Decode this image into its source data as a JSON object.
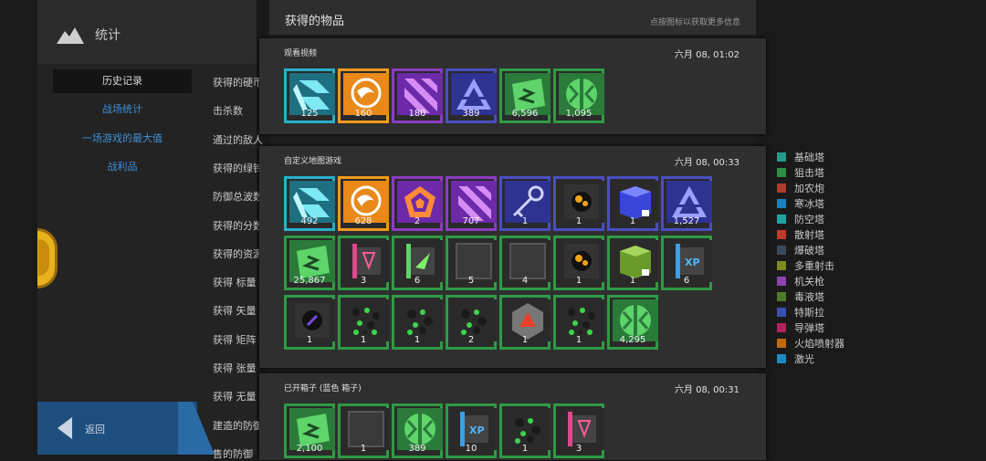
{
  "sidebar": {
    "title": "统计",
    "tabs": [
      {
        "label": "历史记录"
      },
      {
        "label": "战场统计"
      },
      {
        "label": "一场游戏的最大值"
      },
      {
        "label": "战利品"
      }
    ],
    "back_label": "返回"
  },
  "stat_rows": [
    "获得的硬币",
    "击杀数",
    "通过的敌人",
    "获得的绿铃",
    "防御总波数",
    "获得的分数",
    "获得的资源",
    "获得 标量",
    "获得 矢量",
    "获得 矩阵",
    "获得 张量",
    "获得 无量",
    "建造的防御",
    "售的防御"
  ],
  "modal": {
    "title": "获得的物品",
    "hint": "点按图标以获取更多信息"
  },
  "sections": [
    {
      "name": "观看视频",
      "time": "六月 08, 01:02",
      "items": [
        {
          "icon": "cyan-blade-icon",
          "color": "#28b0c8",
          "count": "125"
        },
        {
          "icon": "orange-coin-icon",
          "color": "#f29a1d",
          "count": "160"
        },
        {
          "icon": "purple-stripes-icon",
          "color": "#8c3cc0",
          "count": "180"
        },
        {
          "icon": "blue-triangle-icon",
          "color": "#4a4ec2",
          "count": "389"
        },
        {
          "icon": "green-paper-icon",
          "color": "#2f9a45",
          "count": "6,596"
        },
        {
          "icon": "green-split-icon",
          "color": "#2f9a45",
          "count": "1,095"
        }
      ]
    },
    {
      "name": "自定义地图游戏",
      "time": "六月 08, 00:33",
      "items": [
        {
          "icon": "cyan-blade-icon",
          "color": "#28b0c8",
          "count": "492"
        },
        {
          "icon": "orange-coin-icon",
          "color": "#f29a1d",
          "count": "628"
        },
        {
          "icon": "pentagon-icon",
          "color": "#8c3cc0",
          "count": "2"
        },
        {
          "icon": "purple-stripes-icon",
          "color": "#8c3cc0",
          "count": "707"
        },
        {
          "icon": "key-icon",
          "color": "#4a4ec2",
          "count": "1"
        },
        {
          "icon": "bomb-orb-icon",
          "color": "#4a4ec2",
          "count": "1"
        },
        {
          "icon": "blue-cube-locked-icon",
          "color": "#4a4ec2",
          "count": "1"
        },
        {
          "icon": "blue-triangle-icon",
          "color": "#4a4ec2",
          "count": "1,527"
        },
        {
          "icon": "green-paper-icon",
          "color": "#2f9a45",
          "count": "25,867"
        },
        {
          "icon": "pink-flag-icon",
          "color": "#2f9a45",
          "count": "3"
        },
        {
          "icon": "green-flag-icon",
          "color": "#2f9a45",
          "count": "6"
        },
        {
          "icon": "gray-block-icon",
          "color": "#2f9a45",
          "count": "5"
        },
        {
          "icon": "gray-block-icon",
          "color": "#2f9a45",
          "count": "4"
        },
        {
          "icon": "bomb-orb-icon",
          "color": "#2f9a45",
          "count": "1"
        },
        {
          "icon": "green-cube-locked-icon",
          "color": "#2f9a45",
          "count": "1"
        },
        {
          "icon": "xp-flag-icon",
          "color": "#2f9a45",
          "count": "6"
        },
        {
          "icon": "dark-orb-icon",
          "color": "#2f9a45",
          "count": "1"
        },
        {
          "icon": "green-gems-icon",
          "color": "#2f9a45",
          "count": "1"
        },
        {
          "icon": "dark-gems-icon",
          "color": "#2f9a45",
          "count": "1"
        },
        {
          "icon": "dark-gems-icon",
          "color": "#2f9a45",
          "count": "2"
        },
        {
          "icon": "red-triangle-hex-icon",
          "color": "#2f9a45",
          "count": "1"
        },
        {
          "icon": "green-gems-icon",
          "color": "#2f9a45",
          "count": "1"
        },
        {
          "icon": "green-split-icon",
          "color": "#2f9a45",
          "count": "4,295"
        }
      ]
    },
    {
      "name": "已开箱子 (蓝色 箱子)",
      "time": "六月 08, 00:31",
      "items": [
        {
          "icon": "green-paper-icon",
          "color": "#2f9a45",
          "count": "2,100"
        },
        {
          "icon": "gray-block-icon",
          "color": "#2f9a45",
          "count": "1"
        },
        {
          "icon": "green-split-icon",
          "color": "#2f9a45",
          "count": "389"
        },
        {
          "icon": "xp-flag-icon",
          "color": "#2f9a45",
          "count": "10"
        },
        {
          "icon": "dark-gems-icon",
          "color": "#2f9a45",
          "count": "1"
        },
        {
          "icon": "pink-flag-icon",
          "color": "#2f9a45",
          "count": "3"
        }
      ]
    }
  ],
  "legend": [
    {
      "label": "基础塔",
      "color": "#2b9a8a"
    },
    {
      "label": "狙击塔",
      "color": "#2f8f45"
    },
    {
      "label": "加农炮",
      "color": "#b03a2e"
    },
    {
      "label": "寒冰塔",
      "color": "#1e7fbf"
    },
    {
      "label": "防空塔",
      "color": "#22a3a3"
    },
    {
      "label": "散射塔",
      "color": "#c0392b"
    },
    {
      "label": "爆破塔",
      "color": "#3a4a5a"
    },
    {
      "label": "多重射击",
      "color": "#7e8a1e"
    },
    {
      "label": "机关枪",
      "color": "#8e44ad"
    },
    {
      "label": "毒液塔",
      "color": "#4e7a2a"
    },
    {
      "label": "特斯拉",
      "color": "#3a4fb0"
    },
    {
      "label": "导弹塔",
      "color": "#b0245a"
    },
    {
      "label": "火焰喷射器",
      "color": "#c06a10"
    },
    {
      "label": "激光",
      "color": "#1f8ac0"
    }
  ]
}
